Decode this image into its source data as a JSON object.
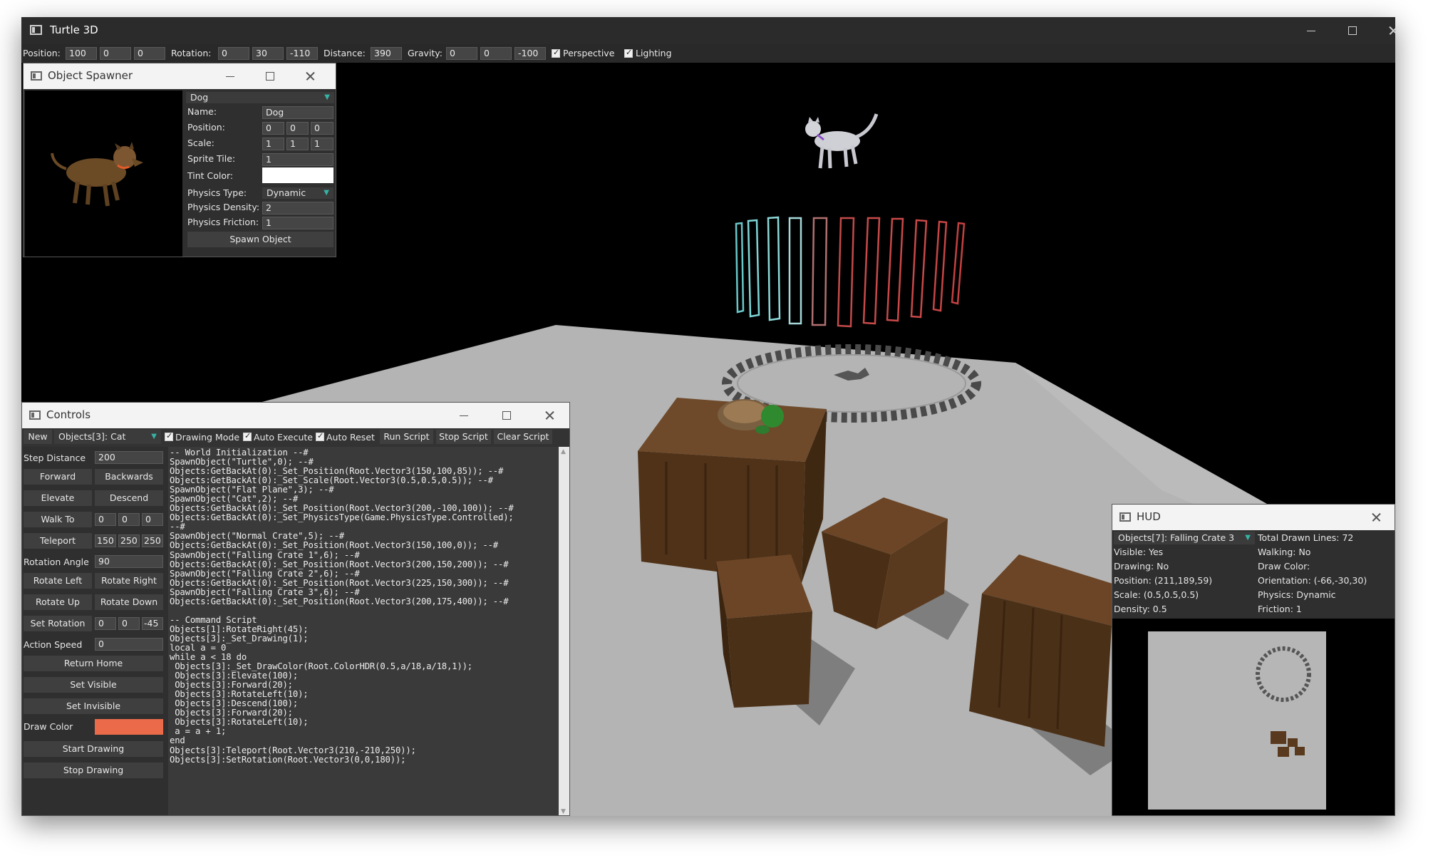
{
  "window": {
    "title": "Turtle 3D"
  },
  "toolbar": {
    "position_label": "Position:",
    "position": [
      "100",
      "0",
      "0"
    ],
    "rotation_label": "Rotation:",
    "rotation": [
      "0",
      "30",
      "-110"
    ],
    "distance_label": "Distance:",
    "distance": "390",
    "gravity_label": "Gravity:",
    "gravity": [
      "0",
      "0",
      "-100"
    ],
    "perspective_label": "Perspective",
    "lighting_label": "Lighting"
  },
  "spawner": {
    "title": "Object Spawner",
    "preset": "Dog",
    "name_label": "Name:",
    "name": "Dog",
    "position_label": "Position:",
    "position": [
      "0",
      "0",
      "0"
    ],
    "scale_label": "Scale:",
    "scale": [
      "1",
      "1",
      "1"
    ],
    "sprite_label": "Sprite Tile:",
    "sprite": "1",
    "tint_label": "Tint Color:",
    "physics_type_label": "Physics Type:",
    "physics_type": "Dynamic",
    "density_label": "Physics Density:",
    "density": "2",
    "friction_label": "Physics Friction:",
    "friction": "1",
    "spawn_button": "Spawn Object"
  },
  "controls": {
    "title": "Controls",
    "new_button": "New",
    "object_select": "Objects[3]: Cat",
    "drawing_mode": "Drawing Mode",
    "auto_execute": "Auto Execute",
    "auto_reset": "Auto Reset",
    "run_script": "Run Script",
    "stop_script": "Stop Script",
    "clear_script": "Clear Script",
    "step_distance_label": "Step Distance",
    "step_distance": "200",
    "forward": "Forward",
    "backwards": "Backwards",
    "elevate": "Elevate",
    "descend": "Descend",
    "walk_to": "Walk To",
    "walk_to_values": [
      "0",
      "0",
      "0"
    ],
    "teleport": "Teleport",
    "teleport_values": [
      "150",
      "250",
      "250"
    ],
    "rotation_angle_label": "Rotation Angle",
    "rotation_angle": "90",
    "rotate_left": "Rotate Left",
    "rotate_right": "Rotate Right",
    "rotate_up": "Rotate Up",
    "rotate_down": "Rotate Down",
    "set_rotation": "Set Rotation",
    "set_rotation_values": [
      "0",
      "0",
      "-45"
    ],
    "action_speed_label": "Action Speed",
    "action_speed": "0",
    "return_home": "Return Home",
    "set_visible": "Set Visible",
    "set_invisible": "Set Invisible",
    "draw_color_label": "Draw Color",
    "start_drawing": "Start Drawing",
    "stop_drawing": "Stop Drawing",
    "script": "-- World Initialization --#\nSpawnObject(\"Turtle\",0); --#\nObjects:GetBackAt(0):_Set_Position(Root.Vector3(150,100,85)); --#\nObjects:GetBackAt(0):_Set_Scale(Root.Vector3(0.5,0.5,0.5)); --#\nSpawnObject(\"Flat Plane\",3); --#\nSpawnObject(\"Cat\",2); --#\nObjects:GetBackAt(0):_Set_Position(Root.Vector3(200,-100,100)); --#\nObjects:GetBackAt(0):_Set_PhysicsType(Game.PhysicsType.Controlled);\n--#\nSpawnObject(\"Normal Crate\",5); --#\nObjects:GetBackAt(0):_Set_Position(Root.Vector3(150,100,0)); --#\nSpawnObject(\"Falling Crate 1\",6); --#\nObjects:GetBackAt(0):_Set_Position(Root.Vector3(200,150,200)); --#\nSpawnObject(\"Falling Crate 2\",6); --#\nObjects:GetBackAt(0):_Set_Position(Root.Vector3(225,150,300)); --#\nSpawnObject(\"Falling Crate 3\",6); --#\nObjects:GetBackAt(0):_Set_Position(Root.Vector3(200,175,400)); --#\n\n-- Command Script\nObjects[1]:RotateRight(45);\nObjects[3]:_Set_Drawing(1);\nlocal a = 0\nwhile a < 18 do\n Objects[3]:_Set_DrawColor(Root.ColorHDR(0.5,a/18,a/18,1));\n Objects[3]:Elevate(100);\n Objects[3]:Forward(20);\n Objects[3]:RotateLeft(10);\n Objects[3]:Descend(100);\n Objects[3]:Forward(20);\n Objects[3]:RotateLeft(10);\n a = a + 1;\nend\nObjects[3]:Teleport(Root.Vector3(210,-210,250));\nObjects[3]:SetRotation(Root.Vector3(0,0,180));"
  },
  "hud": {
    "title": "HUD",
    "object_select": "Objects[7]: Falling Crate 3",
    "total_drawn": "Total Drawn Lines: 72",
    "visible": "Visible: Yes",
    "walking": "Walking: No",
    "drawing": "Drawing: No",
    "draw_color": "Draw Color:",
    "position": "Position: (211,189,59)",
    "orientation": "Orientation: (-66,-30,30)",
    "scale": "Scale: (0.5,0.5,0.5)",
    "physics": "Physics: Dynamic",
    "density": "Density: 0.5",
    "friction": "Friction: 1"
  },
  "colors": {
    "accent_arrow": "#36b3a5",
    "draw_color": "#ea6a4a",
    "ground": "#b4b4b4",
    "crate": "#5a3a1e"
  }
}
